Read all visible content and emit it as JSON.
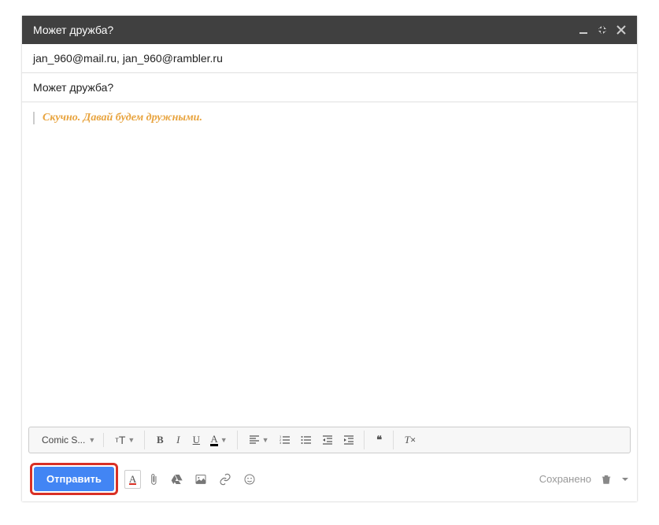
{
  "header": {
    "title": "Может дружба?"
  },
  "fields": {
    "recipients": "jan_960@mail.ru, jan_960@rambler.ru",
    "subject": "Может дружба?"
  },
  "body": {
    "text": "Скучно. Давай будем дружными."
  },
  "toolbar": {
    "font_name": "Comic S...",
    "size_label": "тT",
    "bold": "B",
    "italic": "I",
    "underline": "U",
    "text_color": "A",
    "remove_format": "Tx"
  },
  "bottom": {
    "send_label": "Отправить",
    "format_icon": "A",
    "saved_label": "Сохранено"
  }
}
